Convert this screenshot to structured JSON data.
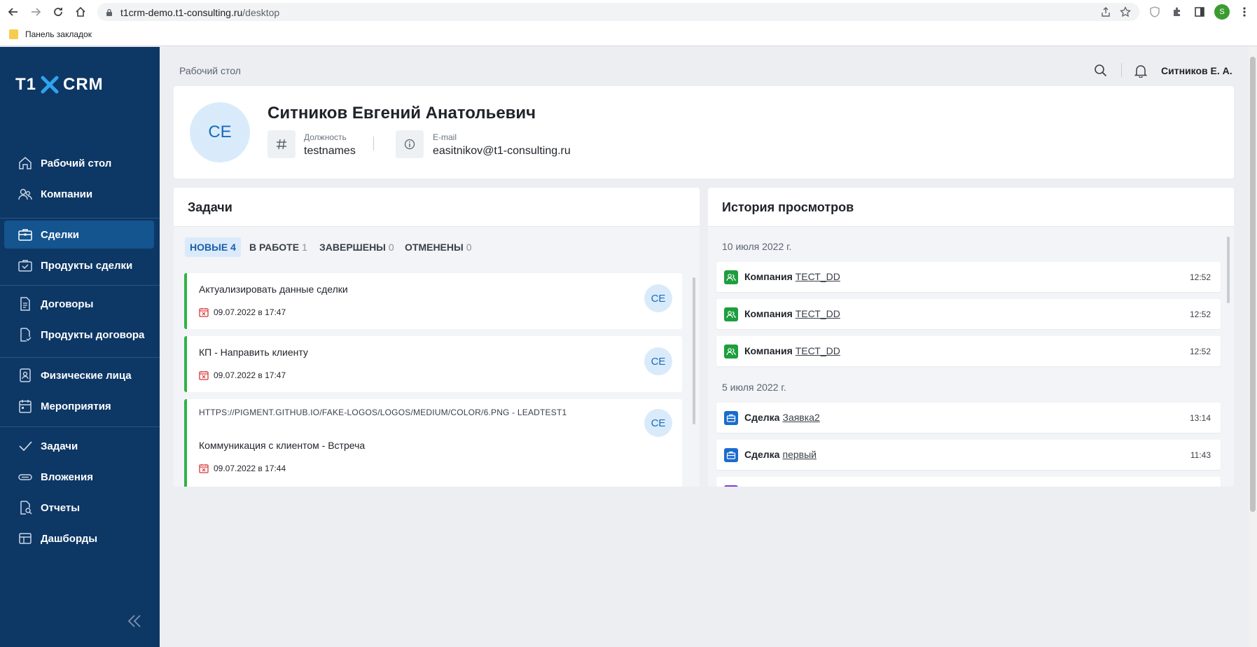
{
  "browser": {
    "url_host": "t1crm-demo.t1-consulting.ru",
    "url_path": "/desktop",
    "bookmarks_label": "Панель закладок",
    "profile_initial": "S"
  },
  "sidebar": {
    "logo_left": "T1",
    "logo_right": "CRM",
    "items": [
      {
        "label": "Рабочий стол",
        "icon": "home-icon"
      },
      {
        "label": "Компании",
        "icon": "users-icon"
      },
      {
        "label": "Сделки",
        "icon": "briefcase-icon",
        "active": true
      },
      {
        "label": "Продукты сделки",
        "icon": "briefcase-check-icon"
      },
      {
        "label": "Договоры",
        "icon": "document-icon"
      },
      {
        "label": "Продукты договора",
        "icon": "document-check-icon"
      },
      {
        "label": "Физические лица",
        "icon": "person-card-icon"
      },
      {
        "label": "Мероприятия",
        "icon": "calendar-icon"
      },
      {
        "label": "Задачи",
        "icon": "check-icon"
      },
      {
        "label": "Вложения",
        "icon": "paperclip-icon"
      },
      {
        "label": "Отчеты",
        "icon": "report-search-icon"
      },
      {
        "label": "Дашборды",
        "icon": "dashboard-icon"
      }
    ]
  },
  "header": {
    "breadcrumb": "Рабочий стол",
    "user_name": "Ситников Е. А."
  },
  "profile": {
    "initials": "СЕ",
    "full_name": "Ситников Евгений Анатольевич",
    "position_label": "Должность",
    "position_value": "testnames",
    "email_label": "E-mail",
    "email_value": "easitnikov@t1-consulting.ru"
  },
  "tasks": {
    "title": "Задачи",
    "tabs": [
      {
        "label": "НОВЫЕ",
        "count": "4",
        "active": true
      },
      {
        "label": "В РАБОТЕ",
        "count": "1"
      },
      {
        "label": "ЗАВЕРШЕНЫ",
        "count": "0"
      },
      {
        "label": "ОТМЕНЕНЫ",
        "count": "0"
      }
    ],
    "items": [
      {
        "title": "Актуализировать данные сделки",
        "date": "09.07.2022 в 17:47",
        "avatar": "СЕ"
      },
      {
        "title": "КП - Направить клиенту",
        "date": "09.07.2022 в 17:47",
        "avatar": "СЕ"
      },
      {
        "link": "HTTPS://PIGMENT.GITHUB.IO/FAKE-LOGOS/LOGOS/MEDIUM/COLOR/6.PNG - LEADTEST1",
        "title": "Коммуникация с клиентом - Встреча",
        "date": "09.07.2022 в 17:44",
        "avatar": "СЕ"
      }
    ]
  },
  "history": {
    "title": "История просмотров",
    "groups": [
      {
        "date": "10 июля 2022 г.",
        "items": [
          {
            "type": "Компания",
            "link": "ТЕСТ_DD",
            "time": "12:52",
            "icon": "company-icon",
            "color": "#1e9e3e"
          },
          {
            "type": "Компания",
            "link": "ТЕСТ_DD",
            "time": "12:52",
            "icon": "company-icon",
            "color": "#1e9e3e"
          },
          {
            "type": "Компания",
            "link": "ТЕСТ_DD",
            "time": "12:52",
            "icon": "company-icon",
            "color": "#1e9e3e"
          }
        ]
      },
      {
        "date": "5 июля 2022 г.",
        "items": [
          {
            "type": "Сделка",
            "link": "Заявка2",
            "time": "13:14",
            "icon": "deal-icon",
            "color": "#1a6bcf"
          },
          {
            "type": "Сделка",
            "link": "первый",
            "time": "11:43",
            "icon": "deal-icon",
            "color": "#1a6bcf"
          }
        ]
      }
    ]
  }
}
